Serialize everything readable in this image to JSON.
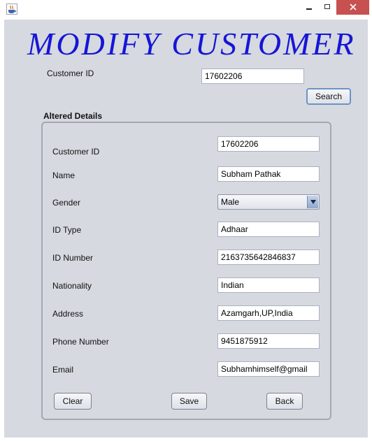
{
  "window": {
    "title": "",
    "controls": {
      "minimize_icon": "minimize-icon",
      "maximize_icon": "maximize-icon",
      "close_icon": "close-icon"
    },
    "app_icon": "java-cup-icon"
  },
  "header": {
    "title": "MODIFY CUSTOMER"
  },
  "search": {
    "customer_id_label": "Customer ID",
    "customer_id_value": "17602206",
    "search_button": "Search"
  },
  "details": {
    "group_title": "Altered Details",
    "fields": {
      "customer_id": {
        "label": "Customer ID",
        "value": "17602206"
      },
      "name": {
        "label": "Name",
        "value": "Subham Pathak"
      },
      "gender": {
        "label": "Gender",
        "value": "Male"
      },
      "id_type": {
        "label": "ID Type",
        "value": "Adhaar"
      },
      "id_number": {
        "label": "ID Number",
        "value": "2163735642846837"
      },
      "nationality": {
        "label": "Nationality",
        "value": "Indian"
      },
      "address": {
        "label": "Address",
        "value": "Azamgarh,UP,India"
      },
      "phone": {
        "label": "Phone Number",
        "value": "9451875912"
      },
      "email": {
        "label": "Email",
        "value": "Subhamhimself@gmail"
      }
    },
    "buttons": {
      "clear": "Clear",
      "save": "Save",
      "back": "Back"
    }
  },
  "colors": {
    "title_blue": "#1616d6",
    "client_background": "#d6d9df",
    "close_button": "#c75050"
  }
}
